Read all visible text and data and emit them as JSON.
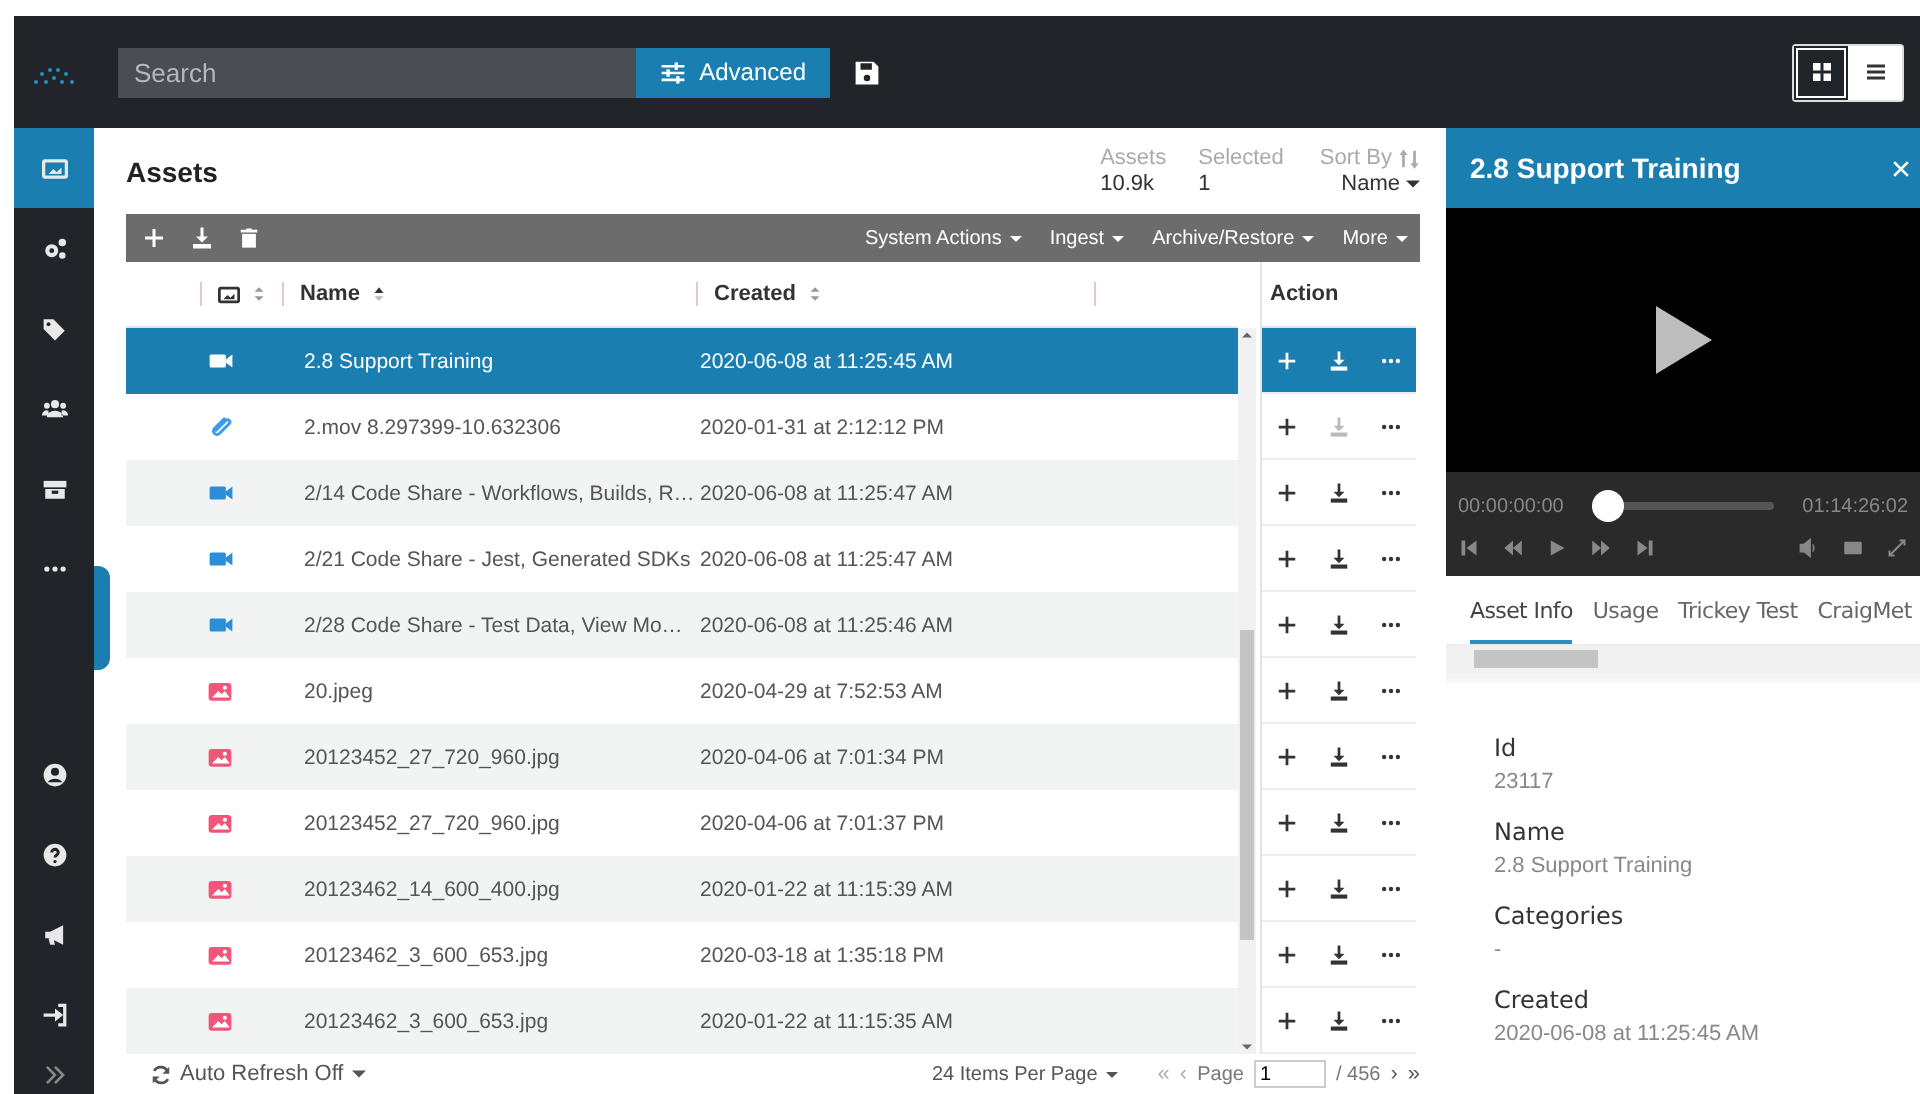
{
  "topbar": {
    "search": {
      "placeholder": "Search"
    },
    "advanced_button": "Advanced",
    "view_toggle": [
      {
        "selected": true
      },
      {
        "selected": false
      }
    ]
  },
  "sidebar": {
    "top_items": [
      {
        "selected": true
      },
      {
        "selected": false
      },
      {
        "selected": false
      },
      {
        "selected": false
      },
      {
        "selected": false
      },
      {
        "selected": false
      }
    ],
    "bottom_items": [
      {
        "selected": false
      },
      {
        "selected": false
      },
      {
        "selected": false
      },
      {
        "selected": false
      },
      {
        "selected": false
      }
    ]
  },
  "assets": {
    "title": "Assets",
    "stats": [
      {
        "label": "Assets",
        "value": "10.9k"
      },
      {
        "label": "Selected",
        "value": "1"
      }
    ],
    "sort": {
      "label": "Sort By",
      "value": "Name"
    },
    "toolbar_menus": [
      "System Actions",
      "Ingest",
      "Archive/Restore",
      "More"
    ],
    "table": {
      "columns": [
        "Name",
        "Created"
      ],
      "action_header": "Action",
      "rows": [
        {
          "kind": "video",
          "name": "2.8 Support Training",
          "created": "2020-06-08 at 11:25:45 AM",
          "selected": true,
          "download_disabled": false
        },
        {
          "kind": "attachment",
          "name": "2.mov 8.297399-10.632306",
          "created": "2020-01-31 at 2:12:12 PM",
          "selected": false,
          "download_disabled": true
        },
        {
          "kind": "video",
          "name": "2/14 Code Share - Workflows, Builds, R…",
          "created": "2020-06-08 at 11:25:47 AM",
          "selected": false,
          "download_disabled": false
        },
        {
          "kind": "video",
          "name": "2/21 Code Share - Jest, Generated SDKs",
          "created": "2020-06-08 at 11:25:47 AM",
          "selected": false,
          "download_disabled": false
        },
        {
          "kind": "video",
          "name": "2/28 Code Share - Test Data, View Mo…",
          "created": "2020-06-08 at 11:25:46 AM",
          "selected": false,
          "download_disabled": false
        },
        {
          "kind": "image",
          "name": "20.jpeg",
          "created": "2020-04-29 at 7:52:53 AM",
          "selected": false,
          "download_disabled": false
        },
        {
          "kind": "image",
          "name": "20123452_27_720_960.jpg",
          "created": "2020-04-06 at 7:01:34 PM",
          "selected": false,
          "download_disabled": false
        },
        {
          "kind": "image",
          "name": "20123452_27_720_960.jpg",
          "created": "2020-04-06 at 7:01:37 PM",
          "selected": false,
          "download_disabled": false
        },
        {
          "kind": "image",
          "name": "20123462_14_600_400.jpg",
          "created": "2020-01-22 at 11:15:39 AM",
          "selected": false,
          "download_disabled": false
        },
        {
          "kind": "image",
          "name": "20123462_3_600_653.jpg",
          "created": "2020-03-18 at 1:35:18 PM",
          "selected": false,
          "download_disabled": false
        },
        {
          "kind": "image",
          "name": "20123462_3_600_653.jpg",
          "created": "2020-01-22 at 11:15:35 AM",
          "selected": false,
          "download_disabled": false
        }
      ]
    },
    "footer": {
      "auto_refresh": "Auto Refresh Off",
      "per_page": "24 Items Per Page",
      "first": "«",
      "prev": "‹",
      "page_label": "Page",
      "page": "1",
      "total": "/ 456",
      "next": "›",
      "last": "»"
    }
  },
  "detail": {
    "title": "2.8 Support Training",
    "player": {
      "current_time": "00:00:00:00",
      "duration": "01:14:26:02",
      "level": 0
    },
    "tabs": [
      {
        "label": "Asset Info",
        "selected": true
      },
      {
        "label": "Usage",
        "selected": false
      },
      {
        "label": "Trickey Test",
        "selected": false
      },
      {
        "label": "CraigMet",
        "selected": false
      }
    ],
    "fields": [
      {
        "label": "Id",
        "value": "23117"
      },
      {
        "label": "Name",
        "value": "2.8 Support Training"
      },
      {
        "label": "Categories",
        "value": "-"
      },
      {
        "label": "Created",
        "value": "2020-06-08 at 11:25:45 AM"
      }
    ]
  }
}
